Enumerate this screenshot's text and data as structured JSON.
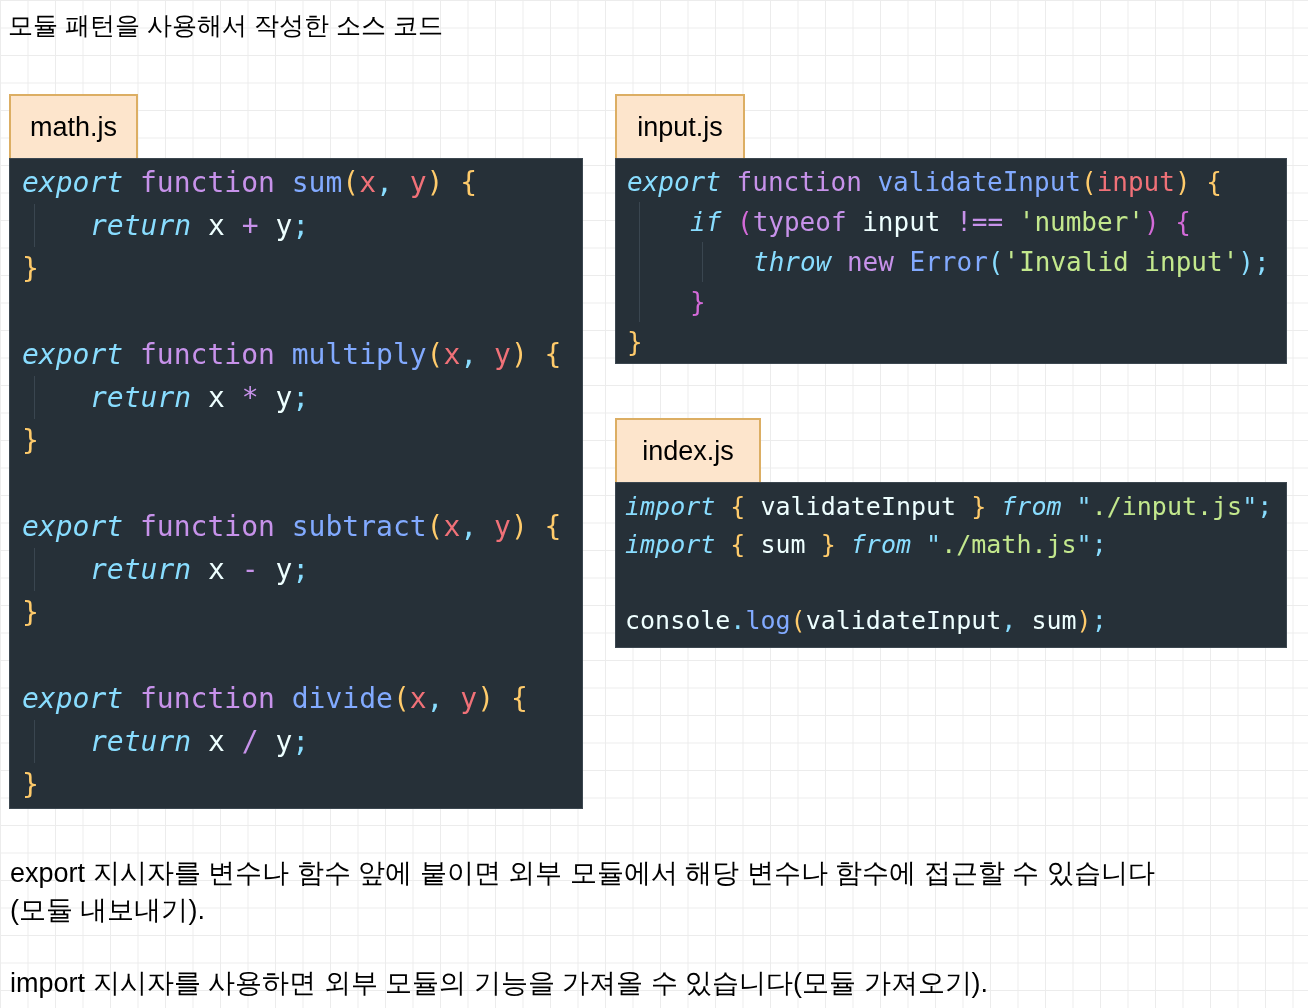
{
  "title": "모듈 패턴을 사용해서 작성한 소스 코드",
  "files": [
    {
      "name": "math.js",
      "blocks": [
        {
          "lines": [
            {
              "tokens": [
                {
                  "kind": "keyword",
                  "text": "export "
                },
                {
                  "kind": "storage",
                  "text": "function "
                },
                {
                  "kind": "function",
                  "text": "sum"
                },
                {
                  "kind": "brace",
                  "text": "("
                },
                {
                  "kind": "param",
                  "text": "x"
                },
                {
                  "kind": "punct",
                  "text": ", "
                },
                {
                  "kind": "param",
                  "text": "y"
                },
                {
                  "kind": "brace",
                  "text": ") {"
                }
              ],
              "children": [
                {
                  "tokens": [
                    {
                      "kind": "keyword",
                      "text": "return "
                    },
                    {
                      "kind": "plain",
                      "text": "x "
                    },
                    {
                      "kind": "operator",
                      "text": "+ "
                    },
                    {
                      "kind": "plain",
                      "text": "y"
                    },
                    {
                      "kind": "punct",
                      "text": ";"
                    }
                  ]
                }
              ]
            },
            {
              "tokens": [
                {
                  "kind": "brace",
                  "text": "}"
                }
              ]
            }
          ]
        },
        {
          "lines": [
            {
              "tokens": [
                {
                  "kind": "keyword",
                  "text": "export "
                },
                {
                  "kind": "storage",
                  "text": "function "
                },
                {
                  "kind": "function",
                  "text": "multiply"
                },
                {
                  "kind": "brace",
                  "text": "("
                },
                {
                  "kind": "param",
                  "text": "x"
                },
                {
                  "kind": "punct",
                  "text": ", "
                },
                {
                  "kind": "param",
                  "text": "y"
                },
                {
                  "kind": "brace",
                  "text": ") {"
                }
              ],
              "children": [
                {
                  "tokens": [
                    {
                      "kind": "keyword",
                      "text": "return "
                    },
                    {
                      "kind": "plain",
                      "text": "x "
                    },
                    {
                      "kind": "operator",
                      "text": "* "
                    },
                    {
                      "kind": "plain",
                      "text": "y"
                    },
                    {
                      "kind": "punct",
                      "text": ";"
                    }
                  ]
                }
              ]
            },
            {
              "tokens": [
                {
                  "kind": "brace",
                  "text": "}"
                }
              ]
            }
          ]
        },
        {
          "lines": [
            {
              "tokens": [
                {
                  "kind": "keyword",
                  "text": "export "
                },
                {
                  "kind": "storage",
                  "text": "function "
                },
                {
                  "kind": "function",
                  "text": "subtract"
                },
                {
                  "kind": "brace",
                  "text": "("
                },
                {
                  "kind": "param",
                  "text": "x"
                },
                {
                  "kind": "punct",
                  "text": ", "
                },
                {
                  "kind": "param",
                  "text": "y"
                },
                {
                  "kind": "brace",
                  "text": ") {"
                }
              ],
              "children": [
                {
                  "tokens": [
                    {
                      "kind": "keyword",
                      "text": "return "
                    },
                    {
                      "kind": "plain",
                      "text": "x "
                    },
                    {
                      "kind": "operator",
                      "text": "- "
                    },
                    {
                      "kind": "plain",
                      "text": "y"
                    },
                    {
                      "kind": "punct",
                      "text": ";"
                    }
                  ]
                }
              ]
            },
            {
              "tokens": [
                {
                  "kind": "brace",
                  "text": "}"
                }
              ]
            }
          ]
        },
        {
          "lines": [
            {
              "tokens": [
                {
                  "kind": "keyword",
                  "text": "export "
                },
                {
                  "kind": "storage",
                  "text": "function "
                },
                {
                  "kind": "function",
                  "text": "divide"
                },
                {
                  "kind": "brace",
                  "text": "("
                },
                {
                  "kind": "param",
                  "text": "x"
                },
                {
                  "kind": "punct",
                  "text": ", "
                },
                {
                  "kind": "param",
                  "text": "y"
                },
                {
                  "kind": "brace",
                  "text": ") {"
                }
              ],
              "children": [
                {
                  "tokens": [
                    {
                      "kind": "keyword",
                      "text": "return "
                    },
                    {
                      "kind": "plain",
                      "text": "x "
                    },
                    {
                      "kind": "operator",
                      "text": "/ "
                    },
                    {
                      "kind": "plain",
                      "text": "y"
                    },
                    {
                      "kind": "punct",
                      "text": ";"
                    }
                  ]
                }
              ]
            },
            {
              "tokens": [
                {
                  "kind": "brace",
                  "text": "}"
                }
              ]
            }
          ]
        }
      ]
    },
    {
      "name": "input.js",
      "blocks": [
        {
          "lines": [
            {
              "tokens": [
                {
                  "kind": "keyword",
                  "text": "export "
                },
                {
                  "kind": "storage",
                  "text": "function "
                },
                {
                  "kind": "function",
                  "text": "validateInput"
                },
                {
                  "kind": "brace",
                  "text": "("
                },
                {
                  "kind": "param",
                  "text": "input"
                },
                {
                  "kind": "brace",
                  "text": ") {"
                }
              ],
              "children": [
                {
                  "tokens": [
                    {
                      "kind": "keyword",
                      "text": "if "
                    },
                    {
                      "kind": "nested",
                      "text": "("
                    },
                    {
                      "kind": "storage",
                      "text": "typeof "
                    },
                    {
                      "kind": "plain",
                      "text": "input "
                    },
                    {
                      "kind": "operator",
                      "text": "!== "
                    },
                    {
                      "kind": "string",
                      "text": "'number'"
                    },
                    {
                      "kind": "nested",
                      "text": ") {"
                    }
                  ],
                  "children": [
                    {
                      "tokens": [
                        {
                          "kind": "keyword",
                          "text": "throw "
                        },
                        {
                          "kind": "storage",
                          "text": "new "
                        },
                        {
                          "kind": "function",
                          "text": "Error"
                        },
                        {
                          "kind": "punct",
                          "text": "("
                        },
                        {
                          "kind": "string",
                          "text": "'Invalid input'"
                        },
                        {
                          "kind": "punct",
                          "text": ");"
                        }
                      ]
                    }
                  ]
                },
                {
                  "tokens": [
                    {
                      "kind": "nested",
                      "text": "}"
                    }
                  ]
                }
              ]
            },
            {
              "tokens": [
                {
                  "kind": "brace",
                  "text": "}"
                }
              ]
            }
          ]
        }
      ]
    },
    {
      "name": "index.js",
      "blocks": [
        {
          "lines": [
            {
              "tokens": [
                {
                  "kind": "keyword",
                  "text": "import "
                },
                {
                  "kind": "brace",
                  "text": "{ "
                },
                {
                  "kind": "plain",
                  "text": "validateInput "
                },
                {
                  "kind": "brace",
                  "text": "} "
                },
                {
                  "kind": "keyword",
                  "text": "from "
                },
                {
                  "kind": "punct",
                  "text": "\""
                },
                {
                  "kind": "string",
                  "text": "./input.js"
                },
                {
                  "kind": "punct",
                  "text": "\";"
                }
              ]
            },
            {
              "tokens": [
                {
                  "kind": "keyword",
                  "text": "import "
                },
                {
                  "kind": "brace",
                  "text": "{ "
                },
                {
                  "kind": "plain",
                  "text": "sum "
                },
                {
                  "kind": "brace",
                  "text": "} "
                },
                {
                  "kind": "keyword",
                  "text": "from "
                },
                {
                  "kind": "punct",
                  "text": "\""
                },
                {
                  "kind": "string",
                  "text": "./math.js"
                },
                {
                  "kind": "punct",
                  "text": "\";"
                }
              ]
            }
          ]
        },
        {
          "lines": [
            {
              "tokens": [
                {
                  "kind": "plain",
                  "text": "console"
                },
                {
                  "kind": "punct",
                  "text": "."
                },
                {
                  "kind": "function",
                  "text": "log"
                },
                {
                  "kind": "brace",
                  "text": "("
                },
                {
                  "kind": "plain",
                  "text": "validateInput"
                },
                {
                  "kind": "punct",
                  "text": ", "
                },
                {
                  "kind": "plain",
                  "text": "sum"
                },
                {
                  "kind": "brace",
                  "text": ")"
                },
                {
                  "kind": "punct",
                  "text": ";"
                }
              ]
            }
          ]
        }
      ]
    }
  ],
  "notes": [
    "export 지시자를 변수나 함수 앞에 붙이면 외부 모듈에서 해당 변수나 함수에 접근할 수 있습니다 (모듈 내보내기).",
    "import 지시자를 사용하면 외부 모듈의 기능을 가져올 수 있습니다(모듈 가져오기)."
  ]
}
